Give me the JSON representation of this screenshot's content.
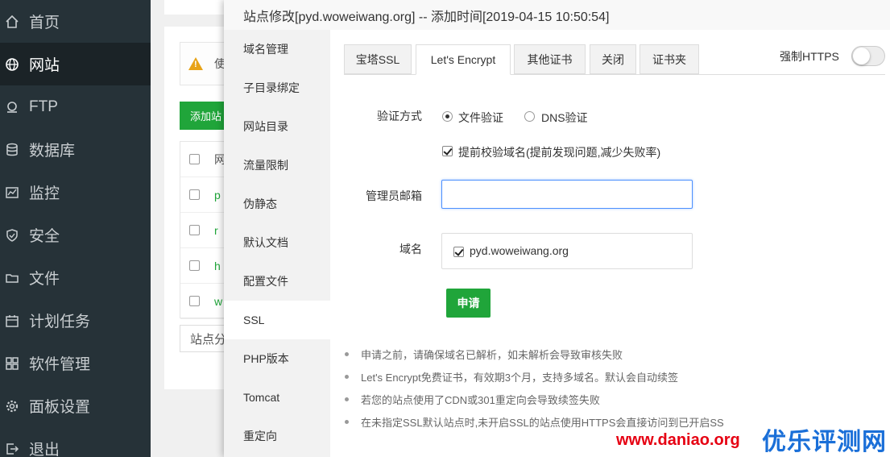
{
  "sidebar": {
    "items": [
      {
        "label": "首页",
        "icon": "home-icon"
      },
      {
        "label": "网站",
        "icon": "globe-icon",
        "active": true
      },
      {
        "label": "FTP",
        "icon": "ftp-icon"
      },
      {
        "label": "数据库",
        "icon": "database-icon"
      },
      {
        "label": "监控",
        "icon": "monitor-icon"
      },
      {
        "label": "安全",
        "icon": "shield-icon"
      },
      {
        "label": "文件",
        "icon": "folder-icon"
      },
      {
        "label": "计划任务",
        "icon": "calendar-icon"
      },
      {
        "label": "软件管理",
        "icon": "apps-icon"
      },
      {
        "label": "面板设置",
        "icon": "gear-icon"
      },
      {
        "label": "退出",
        "icon": "logout-icon"
      }
    ]
  },
  "background": {
    "warning_text": "使",
    "add_button": "添加站",
    "table": {
      "header": "网",
      "rows": [
        "p",
        "r",
        "h",
        "w"
      ]
    },
    "site_category": "站点分"
  },
  "modal": {
    "title": "站点修改[pyd.woweiwang.org] -- 添加时间[2019-04-15 10:50:54]",
    "side_menu": [
      "域名管理",
      "子目录绑定",
      "网站目录",
      "流量限制",
      "伪静态",
      "默认文档",
      "配置文件",
      "SSL",
      "PHP版本",
      "Tomcat",
      "重定向"
    ],
    "side_active_index": 7,
    "tabs": [
      "宝塔SSL",
      "Let's Encrypt",
      "其他证书",
      "关闭",
      "证书夹"
    ],
    "active_tab_index": 1,
    "force_https": {
      "label": "强制HTTPS",
      "enabled": false
    },
    "form": {
      "verify_label": "验证方式",
      "verify_options": [
        {
          "label": "文件验证",
          "checked": true
        },
        {
          "label": "DNS验证",
          "checked": false
        }
      ],
      "precheck": {
        "label": "提前校验域名(提前发现问题,减少失败率)",
        "checked": true
      },
      "email_label": "管理员邮箱",
      "email_value": "",
      "domain_label": "域名",
      "domains": [
        {
          "name": "pyd.woweiwang.org",
          "checked": true
        }
      ],
      "apply_button": "申请"
    },
    "notes": [
      "申请之前，请确保域名已解析，如未解析会导致审核失败",
      "Let's Encrypt免费证书，有效期3个月，支持多域名。默认会自动续签",
      "若您的站点使用了CDN或301重定向会导致续签失败",
      "在未指定SSL默认站点时,未开启SSL的站点使用HTTPS会直接访问到已开启SS"
    ]
  },
  "watermark": {
    "url": "www.daniao.org",
    "text": "优乐评测网"
  },
  "colors": {
    "sidebar_bg": "#263238",
    "accent_green": "#20a53a",
    "focus_blue": "#4d90fe",
    "watermark_red": "#e60012",
    "watermark_blue": "#1a6fd8"
  }
}
